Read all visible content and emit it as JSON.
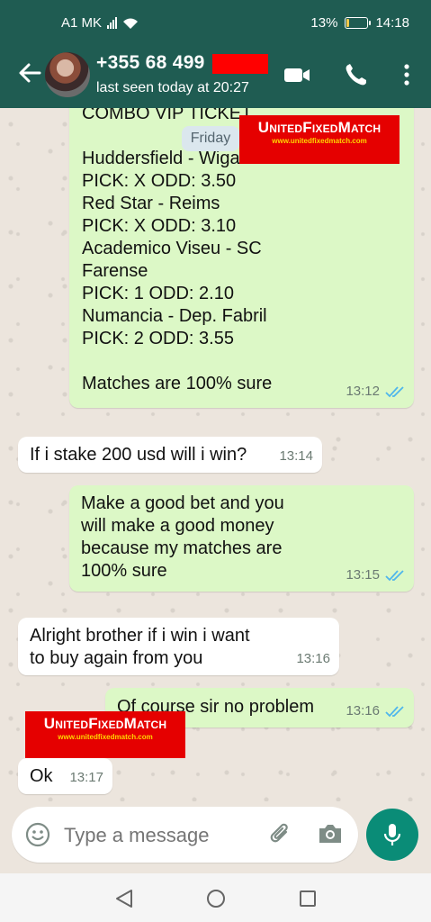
{
  "status_bar": {
    "carrier": "A1 MK",
    "battery_percent": "13%",
    "battery_level": 0.13,
    "time": "14:18"
  },
  "header": {
    "contact_name": "+355 68 499",
    "last_seen": "last seen today at 20:27"
  },
  "chat": {
    "date_chip": "Friday",
    "messages": [
      {
        "direction": "out",
        "lines": [
          "COMBO VIP TICKET",
          "",
          "Huddersfield - Wigan",
          "PICK: X ODD: 3.50",
          "Red Star - Reims",
          "PICK: X ODD: 3.10",
          "Academico Viseu - SC",
          "Farense",
          "PICK: 1 ODD: 2.10",
          "Numancia - Dep. Fabril",
          "PICK: 2 ODD: 3.55",
          "",
          "Matches are 100% sure"
        ],
        "time": "13:12",
        "status": "read"
      },
      {
        "direction": "in",
        "text": "If i stake 200 usd will i win?",
        "time": "13:14"
      },
      {
        "direction": "out",
        "lines": [
          "Make a good bet and you",
          "will make a good money",
          "because my matches are",
          "100% sure"
        ],
        "time": "13:15",
        "status": "read"
      },
      {
        "direction": "in",
        "lines": [
          "Alright brother if i win i want",
          "to buy again from you"
        ],
        "time": "13:16"
      },
      {
        "direction": "out",
        "text": "Of course sir no problem",
        "time": "13:16",
        "status": "read"
      },
      {
        "direction": "in",
        "text": "Ok",
        "time": "13:17"
      }
    ]
  },
  "watermark": {
    "title": "UnitedFixedMatch",
    "url": "www.unitedfixedmatch.com"
  },
  "composer": {
    "placeholder": "Type a message"
  },
  "colors": {
    "header": "#1f5c52",
    "outgoing_bubble": "#dcf8c6",
    "incoming_bubble": "#ffffff",
    "read_ticks": "#4fb6ec",
    "mic_button": "#0a8c77",
    "watermark": "#e50000"
  },
  "icons": [
    "back-arrow-icon",
    "video-call-icon",
    "phone-call-icon",
    "more-options-icon",
    "emoji-icon",
    "attach-icon",
    "camera-icon",
    "mic-icon",
    "read-ticks-icon"
  ]
}
